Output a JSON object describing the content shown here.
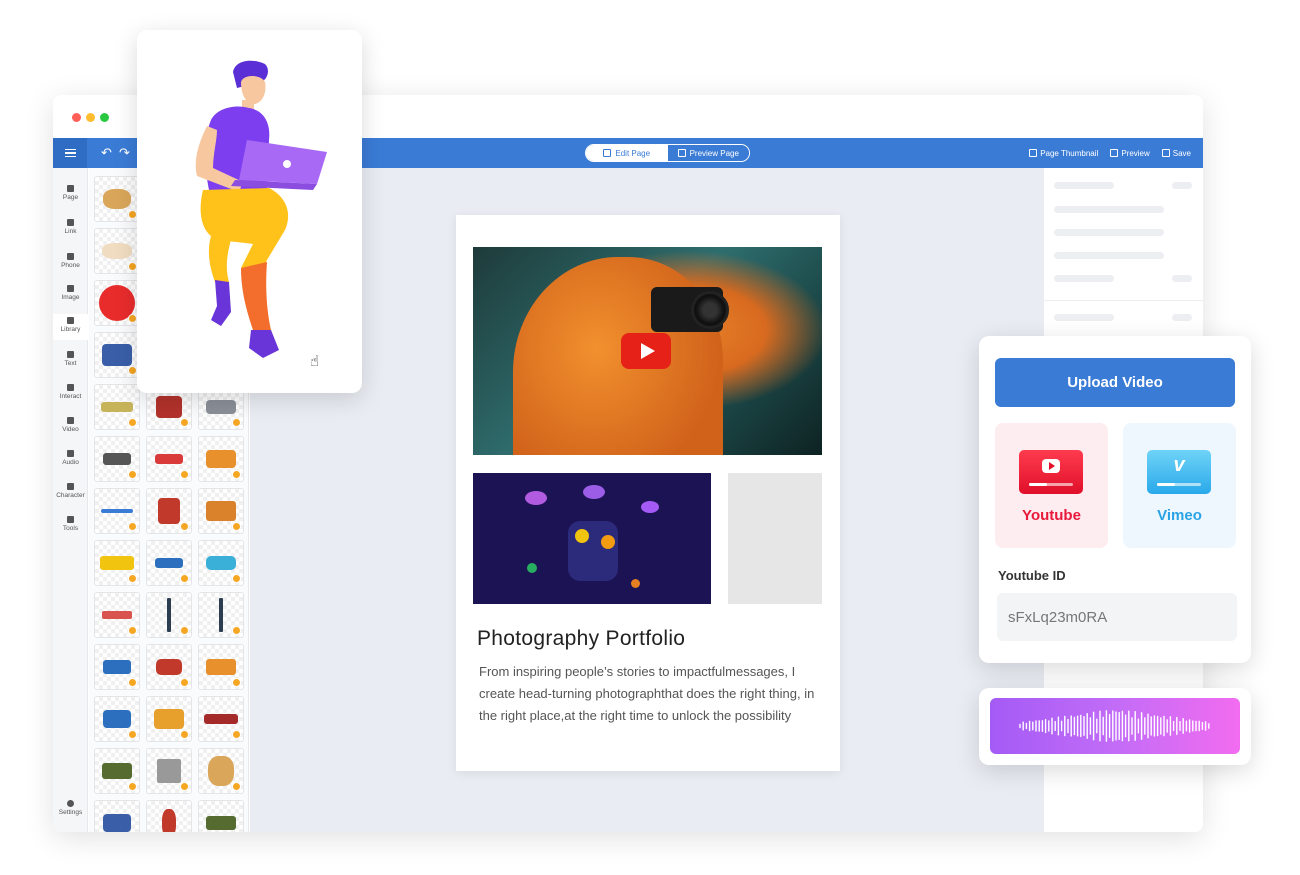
{
  "toolbar": {
    "edit_page": "Edit Page",
    "preview_page": "Preview Page",
    "page_thumbnail": "Page Thumbnail",
    "preview": "Preview",
    "save": "Save"
  },
  "rail": {
    "items": [
      {
        "label": "Page",
        "icon": "page-icon"
      },
      {
        "label": "Link",
        "icon": "link-icon"
      },
      {
        "label": "Phone",
        "icon": "phone-icon"
      },
      {
        "label": "Image",
        "icon": "image-icon"
      },
      {
        "label": "Library",
        "icon": "library-icon"
      },
      {
        "label": "Text",
        "icon": "text-icon"
      },
      {
        "label": "Interact",
        "icon": "interact-icon"
      },
      {
        "label": "Video",
        "icon": "video-icon"
      },
      {
        "label": "Audio",
        "icon": "audio-icon"
      },
      {
        "label": "Character",
        "icon": "character-icon"
      },
      {
        "label": "Tools",
        "icon": "tools-icon"
      }
    ],
    "settings": "Settings"
  },
  "page": {
    "title": "Photography Portfolio",
    "description": "From inspiring people’s stories to impactfulmessages, I create head-turning photographthat does the right thing, in the right place,at the right time to unlock the possibility"
  },
  "upload": {
    "button": "Upload Video",
    "youtube": "Youtube",
    "vimeo": "Vimeo",
    "id_label": "Youtube ID",
    "id_value": "sFxLq23m0RA"
  },
  "colors": {
    "brand": "#3a7bd5",
    "youtube": "#e8193a",
    "vimeo": "#2aa3e6"
  }
}
